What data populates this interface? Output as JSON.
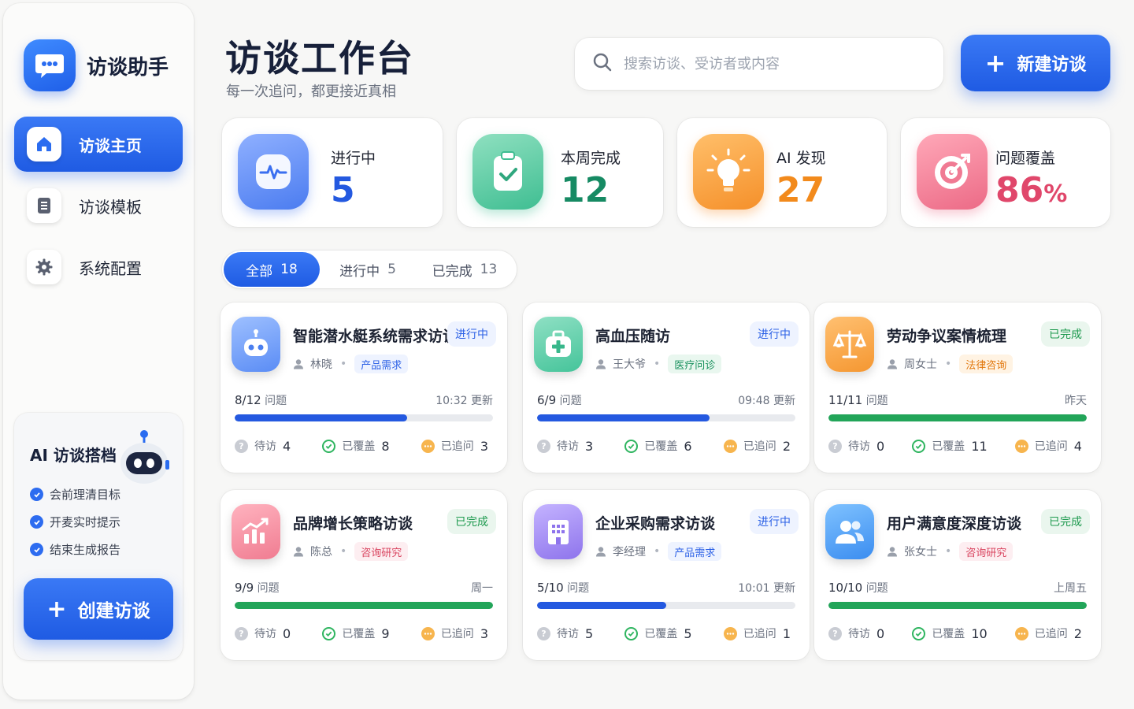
{
  "brand": {
    "name": "访谈助手"
  },
  "nav": [
    {
      "label": "访谈主页",
      "icon": "home-icon",
      "active": true
    },
    {
      "label": "访谈模板",
      "icon": "document-icon",
      "active": false
    },
    {
      "label": "系统配置",
      "icon": "gear-icon",
      "active": false
    }
  ],
  "ai_card": {
    "title": "AI 访谈搭档",
    "features": [
      "会前理清目标",
      "开麦实时提示",
      "结束生成报告"
    ],
    "button_label": "创建访谈"
  },
  "header": {
    "title": "访谈工作台",
    "subtitle": "每一次追问，都更接近真相",
    "search_placeholder": "搜索访谈、受访者或内容",
    "new_button": "新建访谈"
  },
  "stats": [
    {
      "label": "进行中",
      "value": "5",
      "color": "#2459e0",
      "icon": "pulse-icon"
    },
    {
      "label": "本周完成",
      "value": "12",
      "color": "#168a63",
      "icon": "clipboard-check-icon"
    },
    {
      "label": "AI 发现",
      "value": "27",
      "color": "#f28a1c",
      "icon": "lightbulb-icon"
    },
    {
      "label": "问题覆盖",
      "value": "86",
      "unit": "%",
      "color": "#e0476b",
      "icon": "target-icon"
    }
  ],
  "tabs": [
    {
      "label": "全部",
      "count": "18",
      "active": true
    },
    {
      "label": "进行中",
      "count": "5",
      "active": false
    },
    {
      "label": "已完成",
      "count": "13",
      "active": false
    }
  ],
  "cards": [
    {
      "title": "智能潜水艇系统需求访谈",
      "status": "进行中",
      "person": "林晓",
      "tag": "产品需求",
      "tag_color": "#2d62e6",
      "tag_bg": "#eef3ff",
      "progress": "8/12",
      "progress_suffix": "问题",
      "updated": "10:32 更新",
      "ratio": 0.667,
      "pending_label": "待访",
      "pending": "4",
      "covered_label": "已覆盖",
      "covered": "8",
      "followup_label": "已追问",
      "followup": "3",
      "icon": "robot-icon"
    },
    {
      "title": "高血压随访",
      "status": "进行中",
      "person": "王大爷",
      "tag": "医疗问诊",
      "tag_color": "#17905c",
      "tag_bg": "#e9f7ef",
      "progress": "6/9",
      "progress_suffix": "问题",
      "updated": "09:48 更新",
      "ratio": 0.667,
      "pending_label": "待访",
      "pending": "3",
      "covered_label": "已覆盖",
      "covered": "6",
      "followup_label": "已追问",
      "followup": "2",
      "icon": "medical-kit-icon"
    },
    {
      "title": "劳动争议案情梳理",
      "status": "已完成",
      "person": "周女士",
      "tag": "法律咨询",
      "tag_color": "#e2780e",
      "tag_bg": "#fff3e3",
      "progress": "11/11",
      "progress_suffix": "问题",
      "updated": "昨天",
      "ratio": 1.0,
      "pending_label": "待访",
      "pending": "0",
      "covered_label": "已覆盖",
      "covered": "11",
      "followup_label": "已追问",
      "followup": "4",
      "icon": "scales-icon"
    },
    {
      "title": "品牌增长策略访谈",
      "status": "已完成",
      "person": "陈总",
      "tag": "咨询研究",
      "tag_color": "#d9445f",
      "tag_bg": "#fdeef1",
      "progress": "9/9",
      "progress_suffix": "问题",
      "updated": "周一",
      "ratio": 1.0,
      "pending_label": "待访",
      "pending": "0",
      "covered_label": "已覆盖",
      "covered": "9",
      "followup_label": "已追问",
      "followup": "3",
      "icon": "growth-chart-icon"
    },
    {
      "title": "企业采购需求访谈",
      "status": "进行中",
      "person": "李经理",
      "tag": "产品需求",
      "tag_color": "#2d62e6",
      "tag_bg": "#eef3ff",
      "progress": "5/10",
      "progress_suffix": "问题",
      "updated": "10:01 更新",
      "ratio": 0.5,
      "pending_label": "待访",
      "pending": "5",
      "covered_label": "已覆盖",
      "covered": "5",
      "followup_label": "已追问",
      "followup": "1",
      "icon": "building-icon"
    },
    {
      "title": "用户满意度深度访谈",
      "status": "已完成",
      "person": "张女士",
      "tag": "咨询研究",
      "tag_color": "#d9445f",
      "tag_bg": "#fdeef1",
      "progress": "10/10",
      "progress_suffix": "问题",
      "updated": "上周五",
      "ratio": 1.0,
      "pending_label": "待访",
      "pending": "0",
      "covered_label": "已覆盖",
      "covered": "10",
      "followup_label": "已追问",
      "followup": "2",
      "icon": "users-icon"
    }
  ],
  "colors": {
    "accent": "#2563eb",
    "done": "#22a559",
    "running_bar": "#2459e0"
  }
}
